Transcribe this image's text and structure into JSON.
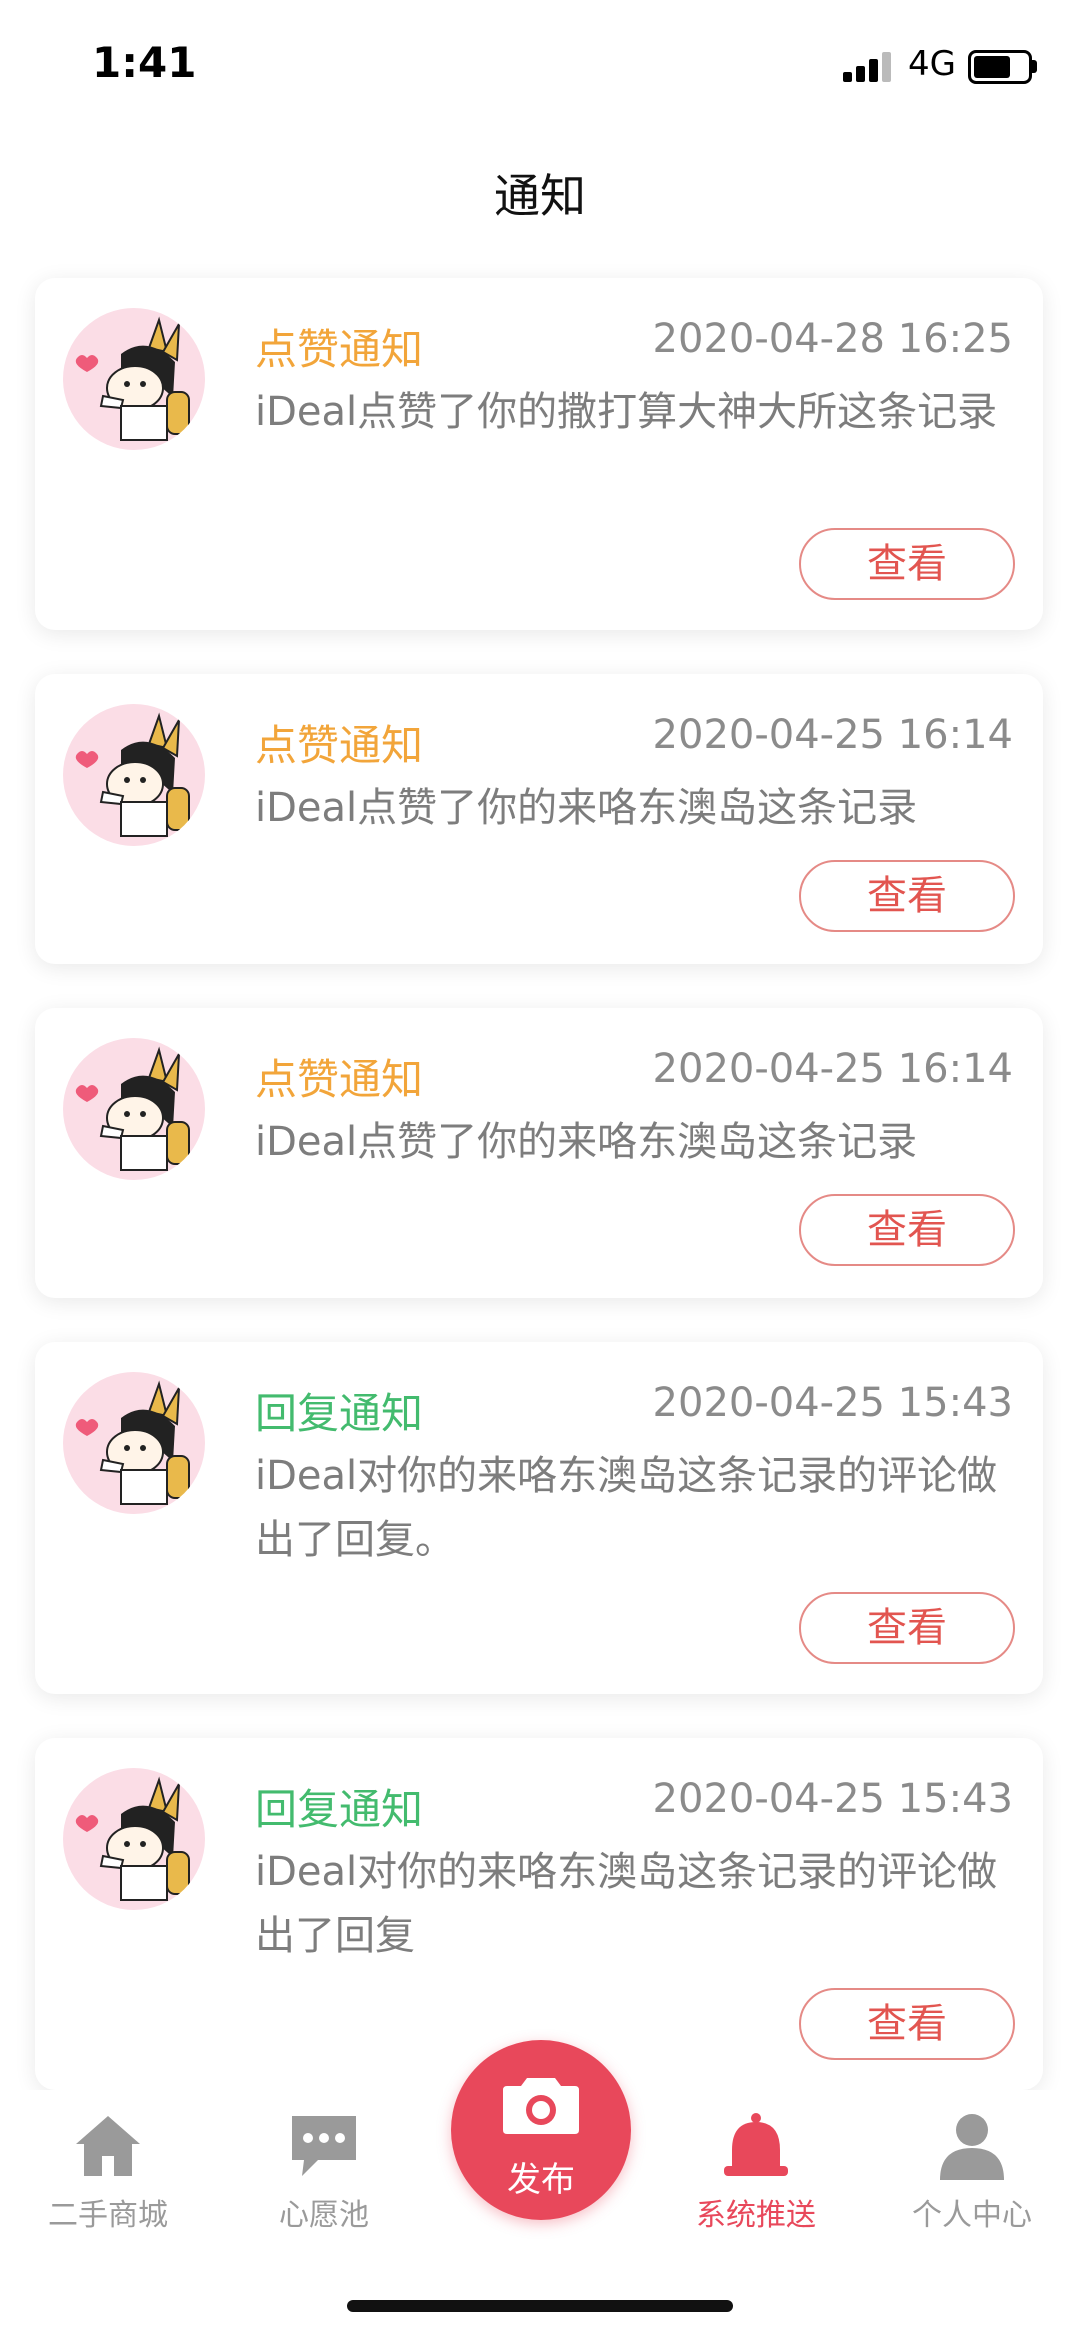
{
  "status_bar": {
    "time": "1:41",
    "network": "4G"
  },
  "header": {
    "title": "通知"
  },
  "notifications": [
    {
      "type": "点赞通知",
      "type_color": "#f2a53a",
      "time": "2020-04-28 16:25",
      "message": "iDeal点赞了你的撒打算大神大所这条记录",
      "action": "查看"
    },
    {
      "type": "点赞通知",
      "type_color": "#f2a53a",
      "time": "2020-04-25 16:14",
      "message": "iDeal点赞了你的来咯东澳岛这条记录",
      "action": "查看"
    },
    {
      "type": "点赞通知",
      "type_color": "#f2a53a",
      "time": "2020-04-25 16:14",
      "message": "iDeal点赞了你的来咯东澳岛这条记录",
      "action": "查看"
    },
    {
      "type": "回复通知",
      "type_color": "#43bb6e",
      "time": "2020-04-25 15:43",
      "message": "iDeal对你的来咯东澳岛这条记录的评论做出了回复。",
      "action": "查看"
    },
    {
      "type": "回复通知",
      "type_color": "#43bb6e",
      "time": "2020-04-25 15:43",
      "message": "iDeal对你的来咯东澳岛这条记录的评论做出了回复",
      "action": "查看"
    }
  ],
  "tabbar": {
    "tabs": [
      {
        "label": "二手商城",
        "icon": "home-icon",
        "active": false
      },
      {
        "label": "心愿池",
        "icon": "chat-bubble-icon",
        "active": false
      },
      {
        "label": "系统推送",
        "icon": "bell-icon",
        "active": true
      },
      {
        "label": "个人中心",
        "icon": "person-icon",
        "active": false
      }
    ],
    "publish": {
      "label": "发布",
      "icon": "camera-icon"
    }
  },
  "colors": {
    "accent": "#e8485b",
    "like_type": "#f2a53a",
    "reply_type": "#43bb6e",
    "button_text": "#e25550"
  }
}
